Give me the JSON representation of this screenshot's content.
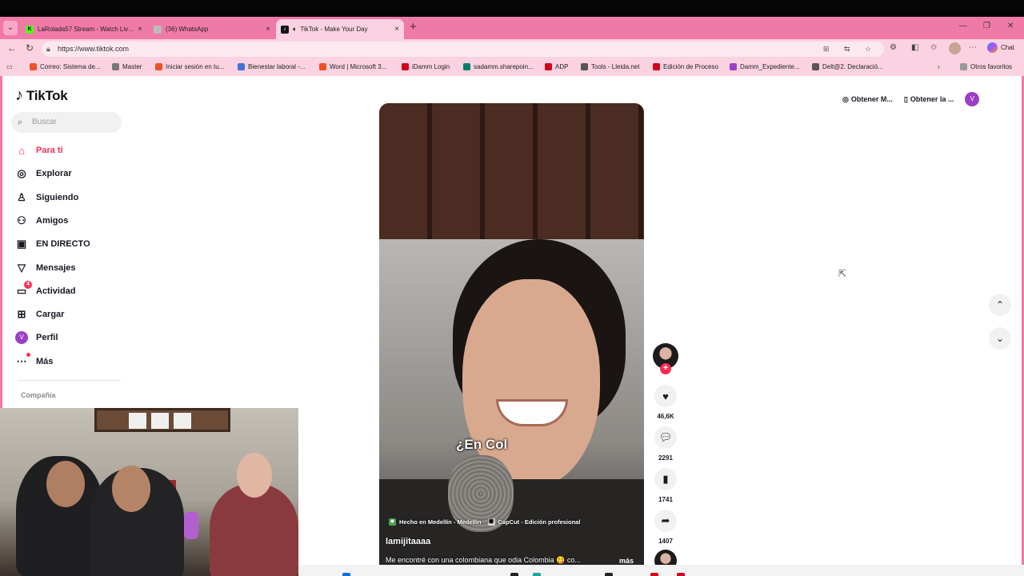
{
  "tabs": [
    {
      "title": "LaRolada57 Stream - Watch Live o",
      "close": "×",
      "active": false,
      "icon_color": "#53fc18",
      "icon_glyph": "K"
    },
    {
      "title": "(36) WhatsApp",
      "close": "×",
      "active": false,
      "icon_color": "#bbbbbb",
      "icon_glyph": ""
    },
    {
      "title": "TikTok - Make Your Day",
      "close": "×",
      "active": true,
      "icon_color": "#111111",
      "icon_glyph": "♪"
    }
  ],
  "address": {
    "url": "https://www.tiktok.com"
  },
  "toolbar": {
    "chat_label": "Chat"
  },
  "bookmarks": [
    {
      "label": "Correo: Sistema de...",
      "color": "#f25022"
    },
    {
      "label": "Master",
      "color": "#777777"
    },
    {
      "label": "Iniciar sesión en tu...",
      "color": "#f25022"
    },
    {
      "label": "Bienestar laboral -...",
      "color": "#3b74d8"
    },
    {
      "label": "Word | Microsoft 3...",
      "color": "#f25022"
    },
    {
      "label": "iDamm Login",
      "color": "#d0021b"
    },
    {
      "label": "sadamm.sharepoin...",
      "color": "#037c6e"
    },
    {
      "label": "ADP",
      "color": "#d0021b"
    },
    {
      "label": "Tools - Lleida.net",
      "color": "#555555"
    },
    {
      "label": "Edición de Proceso",
      "color": "#d0021b"
    },
    {
      "label": "Damm_Expediente...",
      "color": "#9b3fc5"
    },
    {
      "label": "Delt@2. Declaració...",
      "color": "#555555"
    }
  ],
  "bookmarks_other": "Otros favoritos",
  "tiktok": {
    "logo": "TikTok",
    "search_placeholder": "Buscar",
    "nav": [
      {
        "label": "Para ti",
        "icon": "home-icon",
        "active": true
      },
      {
        "label": "Explorar",
        "icon": "compass-icon",
        "active": false
      },
      {
        "label": "Siguiendo",
        "icon": "following-icon",
        "active": false
      },
      {
        "label": "Amigos",
        "icon": "friends-icon",
        "active": false
      },
      {
        "label": "EN DIRECTO",
        "icon": "live-icon",
        "active": false
      },
      {
        "label": "Mensajes",
        "icon": "messages-icon",
        "active": false
      },
      {
        "label": "Actividad",
        "icon": "activity-icon",
        "active": false,
        "badge": "4"
      },
      {
        "label": "Cargar",
        "icon": "upload-icon",
        "active": false
      },
      {
        "label": "Perfil",
        "icon": "avatar-icon",
        "active": false,
        "avatar_letter": "V"
      },
      {
        "label": "Más",
        "icon": "more-icon",
        "active": false
      }
    ],
    "company_label": "Compañía",
    "top_right": {
      "get_app": "Obtener M...",
      "get_desktop": "Obtener la ...",
      "avatar_letter": "V"
    },
    "video": {
      "caption": "¿En Col",
      "tag_location": "Hecho en Medellín - Medellín",
      "tag_capcut": "CapCut - Edición profesional",
      "username": "lamijitaaaa",
      "description": "Me encontré con una colombiana que odia Colombia 😋 co...",
      "more": "más"
    },
    "actions": {
      "likes": "46,6K",
      "comments": "2291",
      "saves": "1741",
      "shares": "1407"
    }
  }
}
